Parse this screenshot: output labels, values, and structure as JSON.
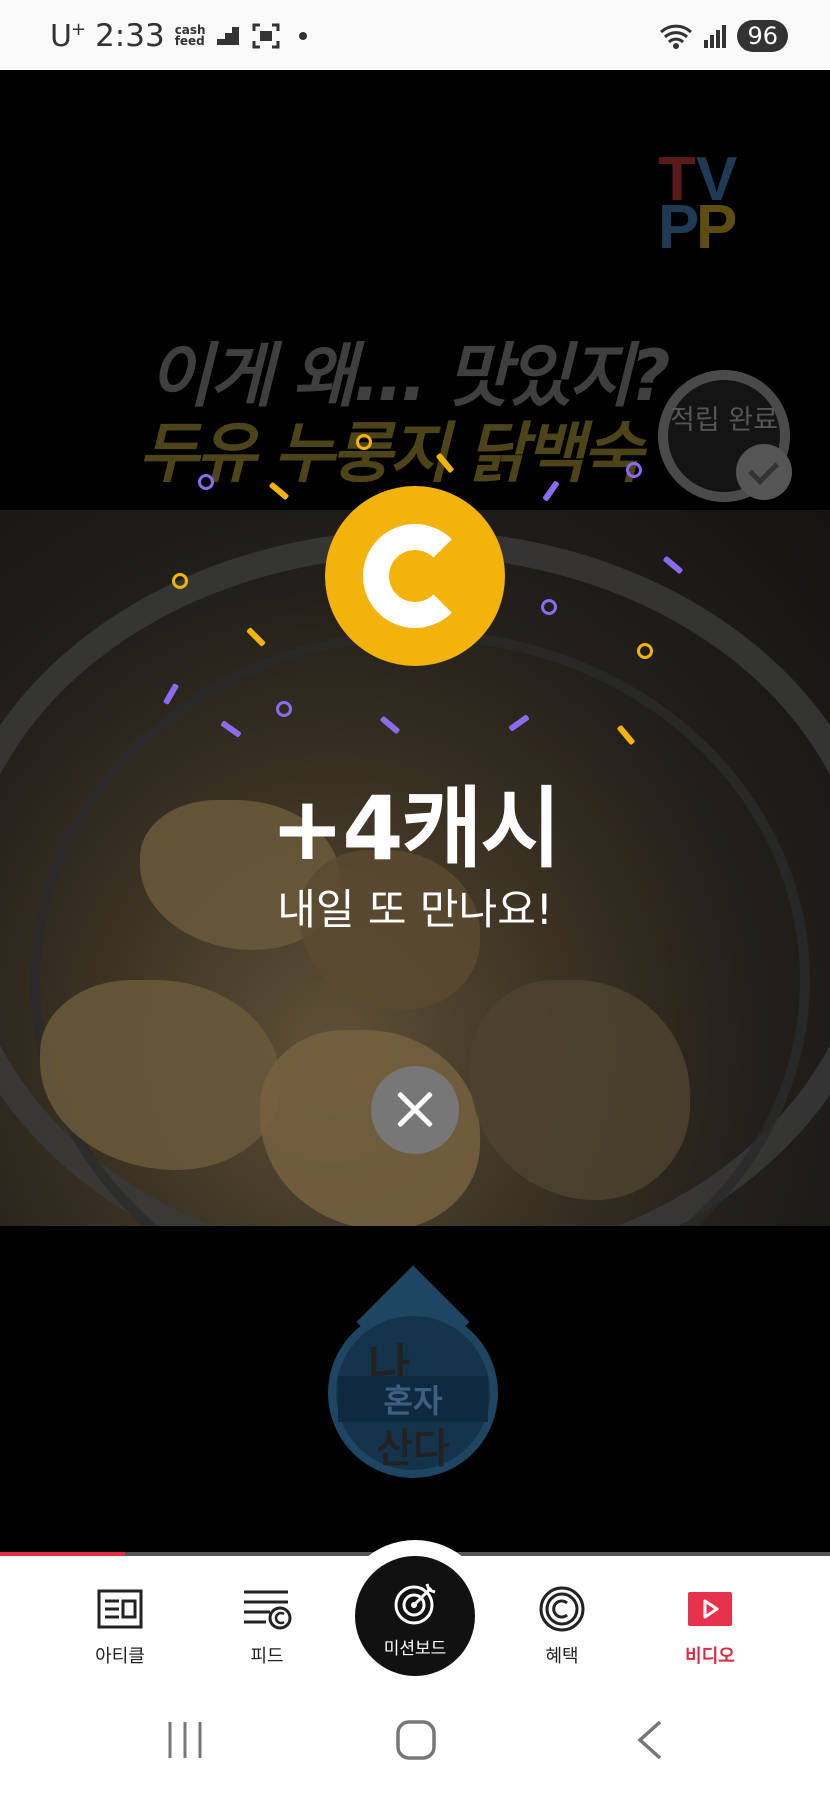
{
  "status_bar": {
    "carrier": "U",
    "carrier_sup": "+",
    "time": "2:33",
    "cashfeed_label": "cash feed",
    "battery": "96"
  },
  "video": {
    "channel_logo": "TVPP",
    "thumbnail_title_line1": "이게 왜... 맛있지?",
    "thumbnail_title_line2": "두유 누룽지 닭백숙",
    "earned_stamp": "적립 완료",
    "channel_brand": {
      "line1": "나",
      "line2": "혼자",
      "line3": "산다"
    }
  },
  "reward_popup": {
    "coin_icon": "cash-coin-icon",
    "amount": "+4캐시",
    "message": "내일 또 만나요!",
    "close_icon": "close-icon"
  },
  "progress": {
    "value": 0.15,
    "color": "#e02e45"
  },
  "bottom_nav": {
    "items": [
      {
        "label": "아티클",
        "icon": "article-icon"
      },
      {
        "label": "피드",
        "icon": "feed-icon"
      },
      {
        "label": "미션보드",
        "icon": "target-icon"
      },
      {
        "label": "혜택",
        "icon": "benefit-coin-icon"
      },
      {
        "label": "비디오",
        "icon": "video-play-icon",
        "active": true
      }
    ]
  },
  "colors": {
    "coin": "#f3b30a",
    "accent": "#d82b48",
    "confetti_purple": "#8b6cf0",
    "confetti_yellow": "#f3b30a"
  }
}
